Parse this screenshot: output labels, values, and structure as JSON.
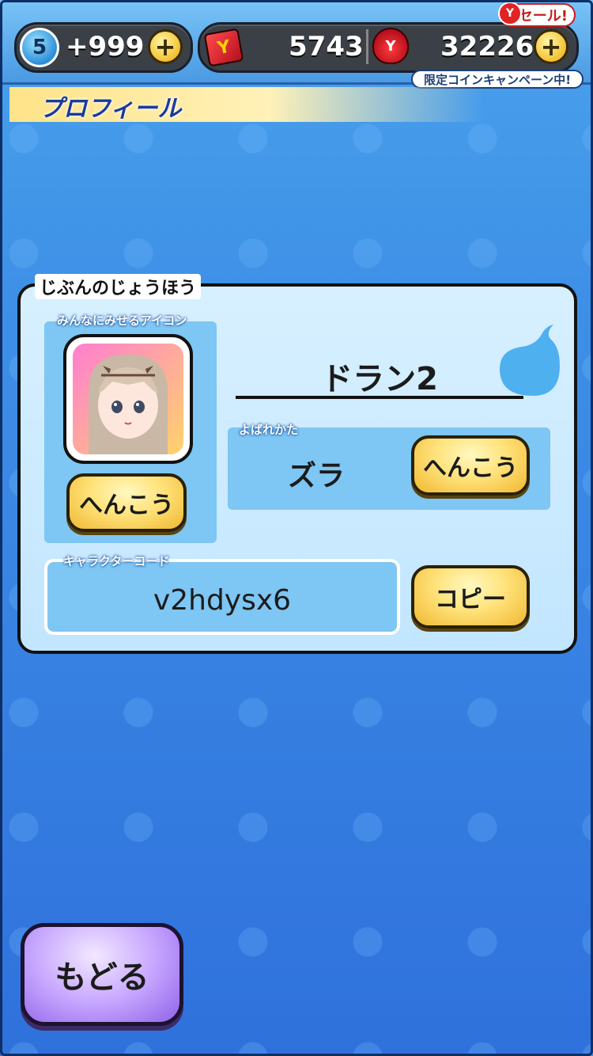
{
  "header": {
    "level": "5",
    "stamina_plus": "+999",
    "plus_symbol": "+",
    "tickets": "5743",
    "coins": "32226",
    "coin_icon_letter": "Y",
    "ticket_icon_letter": "Y",
    "sale_tag": "セール!",
    "campaign_banner": "限定コインキャンペーン中!"
  },
  "page": {
    "title": "プロフィール"
  },
  "profile": {
    "section_label": "じぶんのじょうほう",
    "icon_label": "みんなにみせるアイコン",
    "icon_change_button": "へんこう",
    "player_name": "ドラン2",
    "nickname_label": "よばれかた",
    "nickname_value": "ズラ",
    "nickname_change_button": "へんこう",
    "code_label": "キャラクターコード",
    "code_value": "v2hdysx6",
    "copy_button": "コピー"
  },
  "footer": {
    "back_button": "もどる"
  },
  "colors": {
    "accent_yellow": "#ffe27a",
    "back_purple": "#c7a7ff",
    "panel_bg": "#d7f0ff",
    "bg_blue": "#2f71dc"
  }
}
